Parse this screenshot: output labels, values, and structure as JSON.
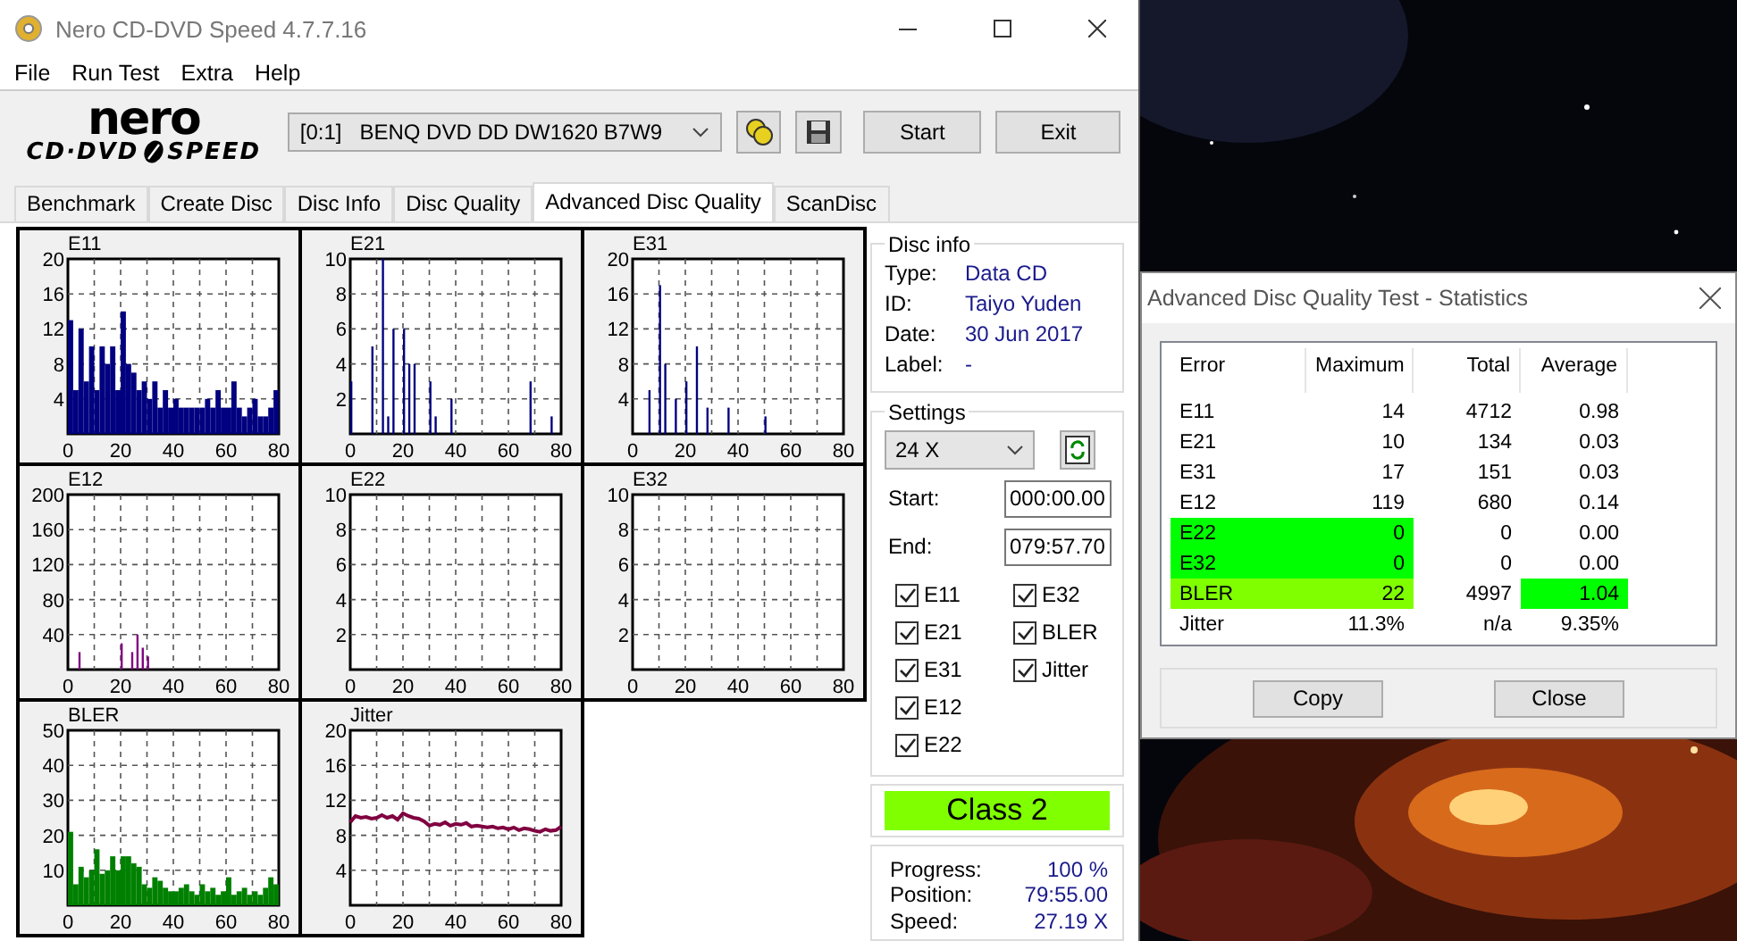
{
  "window": {
    "title": "Nero CD-DVD Speed 4.7.7.16"
  },
  "menu": [
    "File",
    "Run Test",
    "Extra",
    "Help"
  ],
  "logo": {
    "brand": "nero",
    "left": "CD·DVD",
    "right": "SPEED"
  },
  "drive": {
    "value": "[0:1]   BENQ DVD DD DW1620 B7W9"
  },
  "buttons": [
    "Start",
    "Exit"
  ],
  "tabs": [
    {
      "label": "Benchmark",
      "selected": false
    },
    {
      "label": "Create Disc",
      "selected": false
    },
    {
      "label": "Disc Info",
      "selected": false
    },
    {
      "label": "Disc Quality",
      "selected": false
    },
    {
      "label": "Advanced Disc Quality",
      "selected": true
    },
    {
      "label": "ScanDisc",
      "selected": false
    }
  ],
  "charts": [
    {
      "chart_data": {
        "type": "bar",
        "title": "E11",
        "color": "#000080",
        "grid": true,
        "x": [
          0,
          2,
          4,
          6,
          8,
          10,
          12,
          14,
          16,
          18,
          20,
          22,
          24,
          26,
          28,
          30,
          32,
          34,
          36,
          38,
          40,
          42,
          44,
          46,
          48,
          50,
          52,
          54,
          56,
          58,
          60,
          62,
          64,
          66,
          68,
          70,
          72,
          74,
          76,
          78
        ],
        "xlim": [
          0,
          80
        ],
        "ylim": [
          0,
          20
        ],
        "xticks": [
          0,
          20,
          40,
          60,
          80
        ],
        "yticks": [
          4,
          8,
          12,
          16,
          20
        ],
        "values": [
          13,
          5,
          12,
          6,
          10,
          5,
          10,
          8,
          10,
          5,
          14,
          8,
          7,
          5,
          6,
          4,
          6,
          3,
          5,
          3,
          4,
          3,
          3,
          3,
          3,
          3,
          4,
          3,
          5,
          3,
          3,
          6,
          3,
          2,
          3,
          4,
          2,
          2,
          3,
          5
        ]
      }
    },
    {
      "chart_data": {
        "type": "bar",
        "title": "E21",
        "color": "#000080",
        "grid": true,
        "x": [
          0,
          8,
          12,
          14,
          16,
          20,
          22,
          24,
          30,
          32,
          38,
          68,
          76
        ],
        "xlim": [
          0,
          80
        ],
        "ylim": [
          0,
          10
        ],
        "xticks": [
          0,
          20,
          40,
          60,
          80
        ],
        "yticks": [
          2,
          4,
          6,
          8,
          10
        ],
        "values": [
          3,
          5,
          10,
          1,
          6,
          6,
          4,
          4,
          3,
          1,
          2,
          3,
          1
        ]
      }
    },
    {
      "chart_data": {
        "type": "bar",
        "title": "E31",
        "color": "#000080",
        "grid": true,
        "x": [
          6,
          10,
          12,
          16,
          20,
          24,
          28,
          36,
          50
        ],
        "xlim": [
          0,
          80
        ],
        "ylim": [
          0,
          20
        ],
        "xticks": [
          0,
          20,
          40,
          60,
          80
        ],
        "yticks": [
          4,
          8,
          12,
          16,
          20
        ],
        "values": [
          5,
          17,
          8,
          4,
          6,
          10,
          3,
          3,
          2
        ]
      }
    },
    {
      "chart_data": {
        "type": "bar",
        "title": "E12",
        "color": "#800080",
        "grid": true,
        "x": [
          4,
          20,
          24,
          26,
          28,
          30
        ],
        "xlim": [
          0,
          80
        ],
        "ylim": [
          0,
          200
        ],
        "xticks": [
          0,
          20,
          40,
          60,
          80
        ],
        "yticks": [
          40,
          80,
          120,
          160,
          200
        ],
        "values": [
          20,
          30,
          20,
          40,
          25,
          15
        ]
      }
    },
    {
      "chart_data": {
        "type": "bar",
        "title": "E22",
        "grid": true,
        "xlim": [
          0,
          80
        ],
        "ylim": [
          0,
          10
        ],
        "xticks": [
          0,
          20,
          40,
          60,
          80
        ],
        "yticks": [
          2,
          4,
          6,
          8,
          10
        ]
      }
    },
    {
      "chart_data": {
        "type": "bar",
        "title": "E32",
        "grid": true,
        "xlim": [
          0,
          80
        ],
        "ylim": [
          0,
          10
        ],
        "xticks": [
          0,
          20,
          40,
          60,
          80
        ],
        "yticks": [
          2,
          4,
          6,
          8,
          10
        ]
      }
    },
    {
      "chart_data": {
        "type": "bar",
        "title": "BLER",
        "color": "#008000",
        "grid": true,
        "x": [
          0,
          2,
          4,
          6,
          8,
          10,
          12,
          14,
          16,
          18,
          20,
          22,
          24,
          26,
          28,
          30,
          32,
          34,
          36,
          38,
          40,
          42,
          44,
          46,
          48,
          50,
          52,
          54,
          56,
          58,
          60,
          62,
          64,
          66,
          68,
          70,
          72,
          74,
          76,
          78
        ],
        "xlim": [
          0,
          80
        ],
        "ylim": [
          0,
          50
        ],
        "xticks": [
          0,
          20,
          40,
          60,
          80
        ],
        "yticks": [
          10,
          20,
          30,
          40,
          50
        ],
        "values": [
          21,
          6,
          11,
          8,
          10,
          16,
          9,
          10,
          14,
          10,
          14,
          14,
          12,
          11,
          6,
          5,
          8,
          7,
          5,
          4,
          4,
          5,
          6,
          4,
          3,
          6,
          4,
          5,
          3,
          4,
          8,
          3,
          4,
          5,
          3,
          4,
          3,
          5,
          8,
          6
        ]
      }
    },
    {
      "chart_data": {
        "type": "line",
        "title": "Jitter",
        "color": "#800040",
        "grid": true,
        "x": [
          0,
          2,
          4,
          6,
          8,
          10,
          12,
          14,
          16,
          18,
          20,
          22,
          24,
          26,
          28,
          30,
          32,
          34,
          36,
          38,
          40,
          42,
          44,
          46,
          48,
          50,
          52,
          54,
          56,
          58,
          60,
          62,
          64,
          66,
          68,
          70,
          72,
          74,
          76,
          78,
          80
        ],
        "xlim": [
          0,
          80
        ],
        "ylim": [
          0,
          20
        ],
        "xticks": [
          0,
          20,
          40,
          60,
          80
        ],
        "yticks": [
          4,
          8,
          12,
          16,
          20
        ],
        "values": [
          9.5,
          10.2,
          10,
          10.1,
          9.9,
          10,
          10.3,
          10,
          10.2,
          9.8,
          10.5,
          10.2,
          10,
          9.9,
          9.6,
          9.1,
          9.3,
          9.2,
          9.5,
          9.1,
          9.3,
          9.2,
          9.4,
          9,
          9.1,
          9,
          8.9,
          9,
          8.8,
          8.9,
          8.7,
          8.9,
          8.6,
          8.8,
          8.7,
          8.5,
          8.4,
          8.7,
          8.5,
          8.6,
          9
        ]
      }
    }
  ],
  "disc_info": {
    "title": "Disc info",
    "rows": [
      {
        "label": "Type:",
        "value": "Data CD"
      },
      {
        "label": "ID:",
        "value": "Taiyo Yuden"
      },
      {
        "label": "Date:",
        "value": "30 Jun 2017"
      },
      {
        "label": "Label:",
        "value": "-"
      }
    ]
  },
  "settings": {
    "title": "Settings",
    "speed": "24 X",
    "start_label": "Start:",
    "start": "000:00.00",
    "end_label": "End:",
    "end": "079:57.70",
    "checks": [
      {
        "label": "E11",
        "checked": true
      },
      {
        "label": "E21",
        "checked": true
      },
      {
        "label": "E31",
        "checked": true
      },
      {
        "label": "E12",
        "checked": true
      },
      {
        "label": "E22",
        "checked": true
      },
      {
        "label": "E32",
        "checked": true
      },
      {
        "label": "BLER",
        "checked": true
      },
      {
        "label": "Jitter",
        "checked": true
      }
    ]
  },
  "quality_class": {
    "label": "Class 2",
    "color": "#80ff00"
  },
  "progress": [
    {
      "label": "Progress:",
      "value": "100 %"
    },
    {
      "label": "Position:",
      "value": "79:55.00"
    },
    {
      "label": "Speed:",
      "value": "27.19 X"
    }
  ],
  "stats": {
    "title": "Advanced Disc Quality Test - Statistics",
    "columns": [
      "Error",
      "Maximum",
      "Total",
      "Average"
    ],
    "rows": [
      {
        "cells": [
          {
            "text": "E11"
          },
          {
            "text": "14"
          },
          {
            "text": "4712"
          },
          {
            "text": "0.98"
          }
        ]
      },
      {
        "cells": [
          {
            "text": "E21"
          },
          {
            "text": "10"
          },
          {
            "text": "134"
          },
          {
            "text": "0.03"
          }
        ]
      },
      {
        "cells": [
          {
            "text": "E31"
          },
          {
            "text": "17"
          },
          {
            "text": "151"
          },
          {
            "text": "0.03"
          }
        ]
      },
      {
        "cells": [
          {
            "text": "E12"
          },
          {
            "text": "119"
          },
          {
            "text": "680"
          },
          {
            "text": "0.14"
          }
        ]
      },
      {
        "cells": [
          {
            "text": "E22",
            "color": "#00ff00"
          },
          {
            "text": "0",
            "color": "#00ff00"
          },
          {
            "text": "0"
          },
          {
            "text": "0.00"
          }
        ]
      },
      {
        "cells": [
          {
            "text": "E32",
            "color": "#00ff00"
          },
          {
            "text": "0",
            "color": "#00ff00"
          },
          {
            "text": "0"
          },
          {
            "text": "0.00"
          }
        ]
      },
      {
        "cells": [
          {
            "text": "BLER",
            "color": "#80ff00"
          },
          {
            "text": "22",
            "color": "#80ff00"
          },
          {
            "text": "4997"
          },
          {
            "text": "1.04",
            "color": "#00ff00"
          }
        ]
      },
      {
        "cells": [
          {
            "text": "Jitter"
          },
          {
            "text": "11.3%"
          },
          {
            "text": "n/a"
          },
          {
            "text": "9.35%"
          }
        ]
      }
    ],
    "buttons": [
      "Copy",
      "Close"
    ]
  }
}
